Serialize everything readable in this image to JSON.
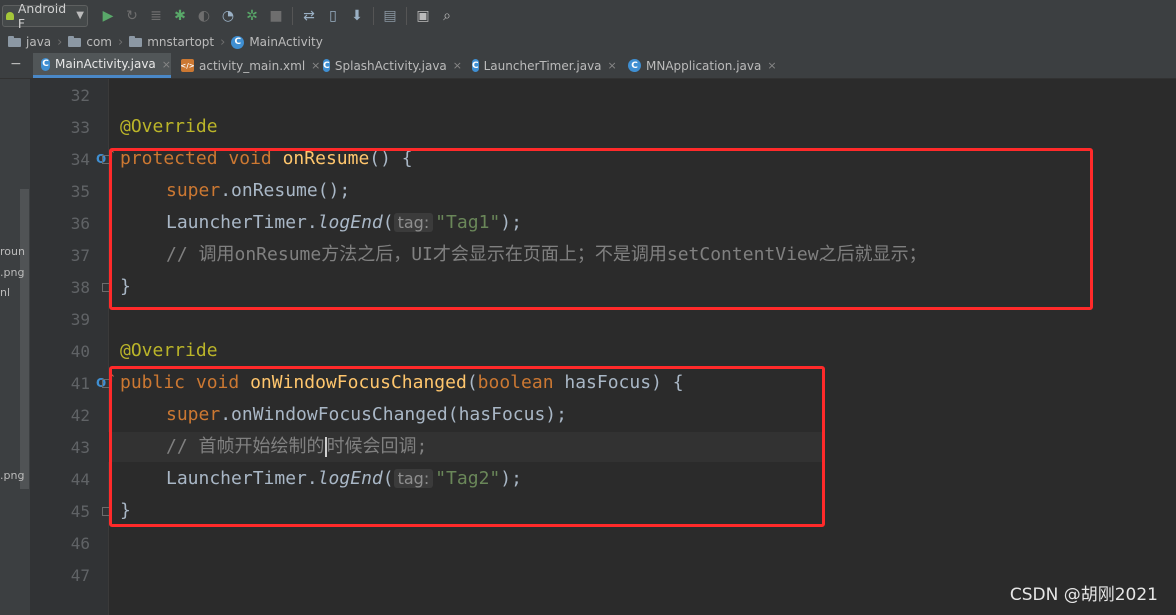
{
  "toolbar": {
    "run_config": "Android F",
    "icons": [
      "run-icon",
      "debug-icon",
      "coverage-icon",
      "profile-icon",
      "attach-debugger-icon",
      "apply-changes-icon",
      "stop-icon",
      "sync-gradle-icon",
      "avd-manager-icon",
      "sdk-manager-icon",
      "project-structure-icon",
      "terminal-icon",
      "search-icon"
    ]
  },
  "breadcrumb": [
    "java",
    "com",
    "mnstartopt",
    "MainActivity"
  ],
  "tabs": [
    {
      "label": "MainActivity.java",
      "active": true
    },
    {
      "label": "activity_main.xml"
    },
    {
      "label": "SplashActivity.java"
    },
    {
      "label": "LauncherTimer.java"
    },
    {
      "label": "MNApplication.java"
    }
  ],
  "project_panel_peek": [
    "roun",
    ".png",
    "nl",
    ".png"
  ],
  "line_numbers": [
    "32",
    "33",
    "34",
    "35",
    "36",
    "37",
    "38",
    "39",
    "40",
    "41",
    "42",
    "43",
    "44",
    "45",
    "46",
    "47"
  ],
  "code": {
    "l33_annotation": "@Override",
    "l34_kw1": "protected",
    "l34_kw2": "void",
    "l34_method": "onResume",
    "l34_rest": "() {",
    "l35_super": "super",
    "l35_rest": ".onResume();",
    "l36_class": "LauncherTimer.",
    "l36_method": "logEnd",
    "l36_open": "(",
    "l36_hint": "tag:",
    "l36_string": "\"Tag1\"",
    "l36_close": ");",
    "l37_comment": "// 调用onResume方法之后，UI才会显示在页面上；不是调用setContentView之后就显示；",
    "l38_brace": "}",
    "l40_annotation": "@Override",
    "l41_kw1": "public",
    "l41_kw2": "void",
    "l41_method": "onWindowFocusChanged",
    "l41_open": "(",
    "l41_kw3": "boolean",
    "l41_rest": " hasFocus) {",
    "l42_super": "super",
    "l42_rest": ".onWindowFocusChanged(hasFocus);",
    "l43_comment_a": "// 首帧开始绘制的",
    "l43_comment_b": "时候会回调;",
    "l44_class": "LauncherTimer.",
    "l44_method": "logEnd",
    "l44_open": "(",
    "l44_hint": "tag:",
    "l44_string": "\"Tag2\"",
    "l44_close": ");",
    "l45_brace": "}"
  },
  "highlight_color": "#ff2a2a",
  "watermark": "CSDN @胡刚2021"
}
